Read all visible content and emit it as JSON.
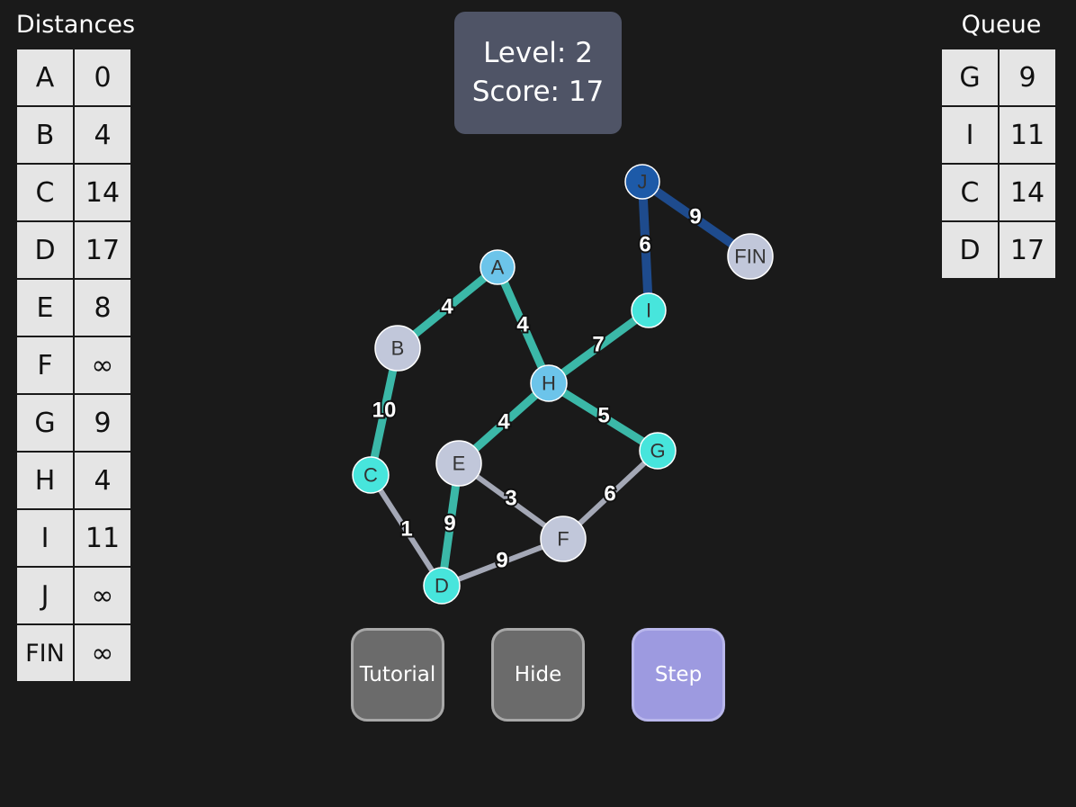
{
  "hud": {
    "level_text": "Level: 2",
    "score_text": "Score: 17"
  },
  "distances": {
    "title": "Distances",
    "rows": [
      {
        "node": "A",
        "dist": "0"
      },
      {
        "node": "B",
        "dist": "4"
      },
      {
        "node": "C",
        "dist": "14"
      },
      {
        "node": "D",
        "dist": "17"
      },
      {
        "node": "E",
        "dist": "8"
      },
      {
        "node": "F",
        "dist": "∞"
      },
      {
        "node": "G",
        "dist": "9"
      },
      {
        "node": "H",
        "dist": "4"
      },
      {
        "node": "I",
        "dist": "11"
      },
      {
        "node": "J",
        "dist": "∞"
      },
      {
        "node": "FIN",
        "dist": "∞"
      }
    ]
  },
  "queue": {
    "title": "Queue",
    "rows": [
      {
        "node": "G",
        "dist": "9"
      },
      {
        "node": "I",
        "dist": "11"
      },
      {
        "node": "C",
        "dist": "14"
      },
      {
        "node": "D",
        "dist": "17"
      }
    ]
  },
  "graph": {
    "nodes": [
      {
        "id": "A",
        "state": "visited"
      },
      {
        "id": "B",
        "state": "unvisited"
      },
      {
        "id": "C",
        "state": "queued"
      },
      {
        "id": "D",
        "state": "queued"
      },
      {
        "id": "E",
        "state": "unvisited"
      },
      {
        "id": "F",
        "state": "unvisited"
      },
      {
        "id": "G",
        "state": "queued"
      },
      {
        "id": "H",
        "state": "visited"
      },
      {
        "id": "I",
        "state": "queued"
      },
      {
        "id": "J",
        "state": "current"
      },
      {
        "id": "FIN",
        "state": "unvisited"
      }
    ],
    "edges": [
      {
        "from": "A",
        "to": "B",
        "weight": "4",
        "state": "explored"
      },
      {
        "from": "A",
        "to": "H",
        "weight": "4",
        "state": "explored"
      },
      {
        "from": "B",
        "to": "C",
        "weight": "10",
        "state": "explored"
      },
      {
        "from": "C",
        "to": "D",
        "weight": "1",
        "state": "default"
      },
      {
        "from": "H",
        "to": "E",
        "weight": "4",
        "state": "explored"
      },
      {
        "from": "E",
        "to": "D",
        "weight": "9",
        "state": "explored"
      },
      {
        "from": "E",
        "to": "F",
        "weight": "3",
        "state": "default"
      },
      {
        "from": "D",
        "to": "F",
        "weight": "9",
        "state": "default"
      },
      {
        "from": "F",
        "to": "G",
        "weight": "6",
        "state": "default"
      },
      {
        "from": "H",
        "to": "G",
        "weight": "5",
        "state": "explored"
      },
      {
        "from": "H",
        "to": "I",
        "weight": "7",
        "state": "explored"
      },
      {
        "from": "I",
        "to": "J",
        "weight": "6",
        "state": "active"
      },
      {
        "from": "J",
        "to": "FIN",
        "weight": "9",
        "state": "active"
      }
    ]
  },
  "colors": {
    "node_visited": "#6cc4ea",
    "node_unvisited": "#c1c7da",
    "node_queued": "#47e5dc",
    "node_current": "#1d5aa8",
    "edge_explored": "#3bb8a8",
    "edge_default": "#a4a8b6",
    "edge_active": "#1e4b8d"
  },
  "buttons": {
    "tutorial": "Tutorial",
    "hide": "Hide",
    "step": "Step"
  }
}
